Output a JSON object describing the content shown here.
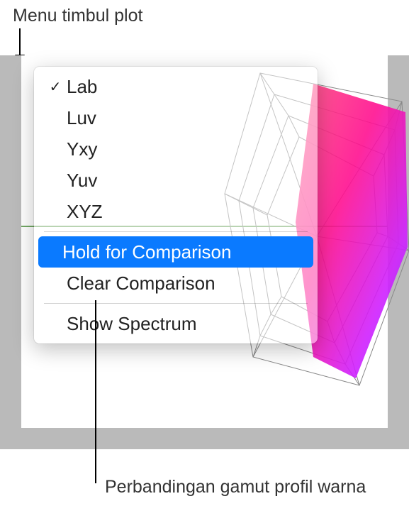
{
  "annotations": {
    "top": "Menu timbul plot",
    "bottom": "Perbandingan gamut profil warna"
  },
  "menu": {
    "items": [
      {
        "label": "Lab",
        "checked": true
      },
      {
        "label": "Luv",
        "checked": false
      },
      {
        "label": "Yxy",
        "checked": false
      },
      {
        "label": "Yuv",
        "checked": false
      },
      {
        "label": "XYZ",
        "checked": false
      }
    ],
    "hold_label": "Hold for Comparison",
    "clear_label": "Clear Comparison",
    "spectrum_label": "Show Spectrum"
  },
  "icons": {
    "checkmark": "✓"
  },
  "colors": {
    "highlight": "#0a7aff"
  }
}
